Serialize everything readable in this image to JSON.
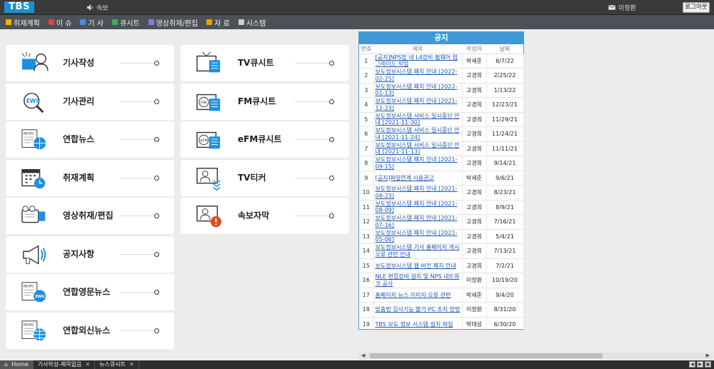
{
  "app": {
    "logo": "TBS",
    "breaking_label": "속보",
    "user_name": "이정환",
    "logout_label": "로그아웃"
  },
  "menu": [
    {
      "label": "취재계획",
      "icon": "note-icon",
      "color": "#f0b400"
    },
    {
      "label": "이 슈",
      "icon": "issue-icon",
      "color": "#e04040"
    },
    {
      "label": "기 사",
      "icon": "article-icon",
      "color": "#3f8fe0"
    },
    {
      "label": "큐시트",
      "icon": "cuesheet-icon",
      "color": "#3fae5a"
    },
    {
      "label": "영상취재/편집",
      "icon": "video-icon",
      "color": "#8a7ae0"
    },
    {
      "label": "자 료",
      "icon": "archive-icon",
      "color": "#f0a000"
    },
    {
      "label": "시스템",
      "icon": "gear-icon",
      "color": "#cccccc"
    }
  ],
  "tiles_left": [
    {
      "label": "기사작성",
      "icon": "writer-icon"
    },
    {
      "label": "기사관리",
      "icon": "news-search-icon"
    },
    {
      "label": "연합뉴스",
      "icon": "news-globe-icon"
    },
    {
      "label": "취재계획",
      "icon": "calendar-icon"
    },
    {
      "label": "영상취재/편집",
      "icon": "camera-icon"
    },
    {
      "label": "공지사항",
      "icon": "megaphone-icon"
    },
    {
      "label": "연합영문뉴스",
      "icon": "news-eng-icon"
    },
    {
      "label": "연합외신뉴스",
      "icon": "news-foreign-icon"
    }
  ],
  "tiles_right": [
    {
      "label": "TV큐시트",
      "icon": "tv-icon"
    },
    {
      "label": "FM큐시트",
      "icon": "fm-radio-icon"
    },
    {
      "label": "eFM큐시트",
      "icon": "efm-radio-icon"
    },
    {
      "label": "TV티커",
      "icon": "ticker-icon"
    },
    {
      "label": "속보자막",
      "icon": "breaking-caption-icon"
    }
  ],
  "notice": {
    "title": "공지",
    "columns": [
      "번호",
      "제목",
      "작성자",
      "날짜"
    ],
    "rows": [
      {
        "num": "1",
        "title": "[공지]NPS망 내 L4장비 펌웨어 업그레이드 작업",
        "author": "박세준",
        "date": "6/7/22"
      },
      {
        "num": "2",
        "title": "보도정보시스템 패치 안내 [2022-02-25]",
        "author": "고경희",
        "date": "2/25/22"
      },
      {
        "num": "3",
        "title": "보도정보시스템 패치 안내 [2022-01-13]",
        "author": "고경희",
        "date": "1/13/22"
      },
      {
        "num": "4",
        "title": "보도정보시스템 패치 안내 [2021-12-23]",
        "author": "고경희",
        "date": "12/23/21"
      },
      {
        "num": "5",
        "title": "보도정보시스템 서비스 일시중단 안내 [2021-11-30]",
        "author": "고경희",
        "date": "11/29/21"
      },
      {
        "num": "6",
        "title": "보도정보시스템 서비스 일시중단 안내 [2021-11-24]",
        "author": "고경희",
        "date": "11/24/21"
      },
      {
        "num": "7",
        "title": "보도정보시스템 서비스 일시중단 안내 [2021-11-13]",
        "author": "고경희",
        "date": "11/11/21"
      },
      {
        "num": "8",
        "title": "보도정보시스템 패치 안내 [2021-09-15]",
        "author": "고경희",
        "date": "9/14/21"
      },
      {
        "num": "9",
        "title": "[공지]파일연계 사용권고",
        "author": "박세준",
        "date": "9/6/21"
      },
      {
        "num": "10",
        "title": "보도정보시스템 패치 안내 [2021-08-23]",
        "author": "고경희",
        "date": "8/23/21"
      },
      {
        "num": "11",
        "title": "보도정보시스템 패치 안내 [2021-08-09]",
        "author": "고경희",
        "date": "8/9/21"
      },
      {
        "num": "12",
        "title": "보도정보시스템 패치 안내 [2021-07-16]",
        "author": "고경희",
        "date": "7/16/21"
      },
      {
        "num": "13",
        "title": "보도정보시스템 패치 안내 [2021-05-06]",
        "author": "고경희",
        "date": "5/4/21"
      },
      {
        "num": "14",
        "title": "보도정보시스템 기사 홈페이지 게시 오류 관련 안내",
        "author": "고경희",
        "date": "7/13/21"
      },
      {
        "num": "15",
        "title": "보도정보시스템 웹 버전 패치 안내",
        "author": "고경희",
        "date": "7/2/21"
      },
      {
        "num": "16",
        "title": "NLE 편집장비 설치 및 NPS 네트워크 공사",
        "author": "이정환",
        "date": "10/19/20"
      },
      {
        "num": "17",
        "title": "홈페이지 뉴스 이미지 오류 관련",
        "author": "박세준",
        "date": "9/4/20"
      },
      {
        "num": "18",
        "title": "맞춤법 검사기능 불가 PC 조치 방법",
        "author": "이정환",
        "date": "8/31/20"
      },
      {
        "num": "19",
        "title": "TBS 보도 정보 시스템 설치 파일",
        "author": "박대성",
        "date": "6/30/20"
      }
    ]
  },
  "bottom_tabs": [
    {
      "label": "Home",
      "closable": false,
      "active": true
    },
    {
      "label": "기사작성-제목없음",
      "closable": true,
      "active": false
    },
    {
      "label": "뉴스큐시트",
      "closable": true,
      "active": false
    }
  ]
}
